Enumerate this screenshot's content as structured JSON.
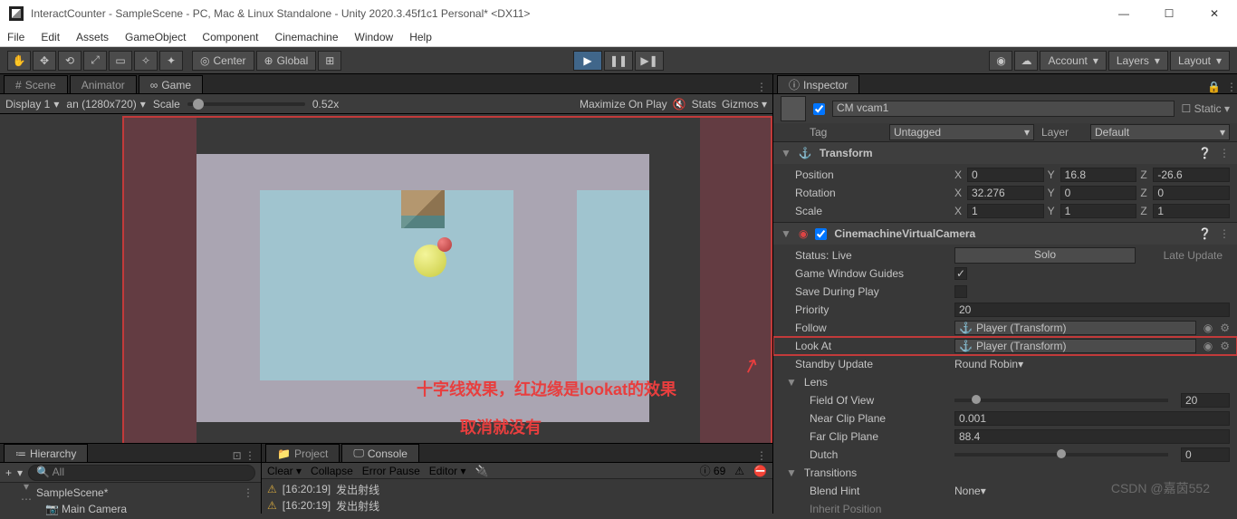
{
  "window": {
    "title": "InteractCounter - SampleScene - PC, Mac & Linux Standalone - Unity 2020.3.45f1c1 Personal* <DX11>",
    "min": "—",
    "max": "☐",
    "close": "✕"
  },
  "menu": [
    "File",
    "Edit",
    "Assets",
    "GameObject",
    "Component",
    "Cinemachine",
    "Window",
    "Help"
  ],
  "toolbar": {
    "center": "Center",
    "global": "Global",
    "account": "Account",
    "layers": "Layers",
    "layout": "Layout"
  },
  "leftTabs": {
    "scene": "Scene",
    "animator": "Animator",
    "game": "Game"
  },
  "gameBar": {
    "display": "Display 1",
    "aspect": "an (1280x720)",
    "scaleLabel": "Scale",
    "scaleVal": "0.52x",
    "maximize": "Maximize On Play",
    "stats": "Stats",
    "gizmos": "Gizmos"
  },
  "annotations": {
    "line1": "十字线效果，红边缘是lookat的效果",
    "line2": "取消就没有",
    "arrow": "↗"
  },
  "hierarchy": {
    "tab": "Hierarchy",
    "plus": "+",
    "searchPh": "All",
    "scene": "SampleScene*",
    "child1": "Main Camera"
  },
  "project": {
    "tabProject": "Project",
    "tabConsole": "Console",
    "clear": "Clear",
    "collapse": "Collapse",
    "errorPause": "Error Pause",
    "editor": "Editor",
    "count": "69",
    "log1time": "[16:20:19]",
    "log1msg": "发出射线",
    "log2time": "[16:20:19]",
    "log2msg": "发出射线"
  },
  "inspector": {
    "tab": "Inspector",
    "name": "CM vcam1",
    "static": "Static",
    "tagLabel": "Tag",
    "tagValue": "Untagged",
    "layerLabel": "Layer",
    "layerValue": "Default",
    "transform": {
      "title": "Transform",
      "position": "Position",
      "px": "0",
      "py": "16.8",
      "pz": "-26.6",
      "rotation": "Rotation",
      "rx": "32.276",
      "ry": "0",
      "rz": "0",
      "scale": "Scale",
      "sx": "1",
      "sy": "1",
      "sz": "1"
    },
    "cvc": {
      "title": "CinemachineVirtualCamera",
      "statusLabel": "Status: Live",
      "solo": "Solo",
      "lateUpdate": "Late Update",
      "guides": "Game Window Guides",
      "guidesChk": "✓",
      "saveDuring": "Save During Play",
      "priority": "Priority",
      "priorityVal": "20",
      "follow": "Follow",
      "followVal": "Player (Transform)",
      "lookAt": "Look At",
      "lookAtVal": "Player (Transform)",
      "standby": "Standby Update",
      "standbyVal": "Round Robin",
      "lens": "Lens",
      "fov": "Field Of View",
      "fovVal": "20",
      "nearClip": "Near Clip Plane",
      "nearVal": "0.001",
      "farClip": "Far Clip Plane",
      "farVal": "88.4",
      "dutch": "Dutch",
      "dutchVal": "0",
      "transitions": "Transitions",
      "blendHint": "Blend Hint",
      "blendHintVal": "None",
      "inherit": "Inherit Position"
    }
  },
  "watermark": "CSDN @嘉茵552"
}
